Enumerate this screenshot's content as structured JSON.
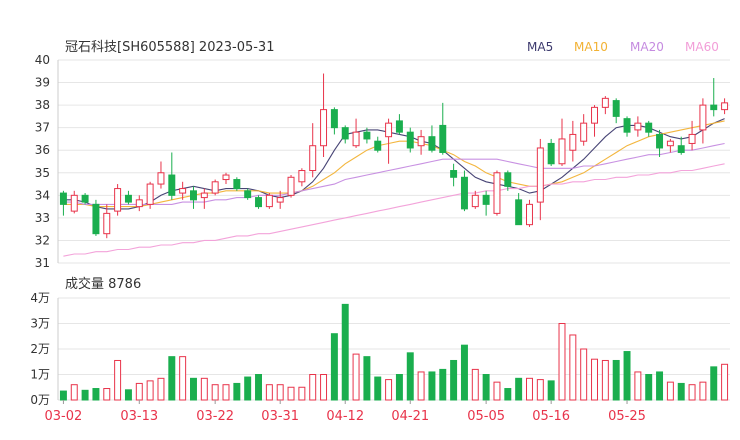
{
  "header": {
    "title": "冠石科技[SH605588] 2023-05-31"
  },
  "legend": [
    {
      "label": "MA5",
      "color": "#3d3a6e"
    },
    {
      "label": "MA10",
      "color": "#f2b234"
    },
    {
      "label": "MA20",
      "color": "#c58be0"
    },
    {
      "label": "MA60",
      "color": "#f29ed8"
    }
  ],
  "volume_panel": {
    "label": "成交量 8786"
  },
  "colors": {
    "up": "#e8334a",
    "down": "#1aae4e",
    "grid": "#e6e6e6",
    "axis_text": "#333333",
    "date_text": "#e8334a"
  },
  "chart_data": [
    {
      "type": "candlestick",
      "title": "冠石科技[SH605588] 2023-05-31",
      "ylim": [
        31,
        40
      ],
      "yticks": [
        31,
        32,
        33,
        34,
        35,
        36,
        37,
        38,
        39,
        40
      ],
      "x_tick_labels": [
        "03-02",
        "03-13",
        "03-22",
        "03-31",
        "04-12",
        "04-21",
        "05-05",
        "05-16",
        "05-25"
      ],
      "candles": [
        {
          "date": "03-02",
          "o": 34.1,
          "h": 34.2,
          "l": 33.1,
          "c": 33.6
        },
        {
          "o": 33.3,
          "h": 34.2,
          "l": 33.2,
          "c": 34.0
        },
        {
          "o": 34.0,
          "h": 34.1,
          "l": 33.6,
          "c": 33.7
        },
        {
          "o": 33.6,
          "h": 33.8,
          "l": 32.2,
          "c": 32.3
        },
        {
          "o": 32.3,
          "h": 33.6,
          "l": 32.1,
          "c": 33.2
        },
        {
          "o": 33.3,
          "h": 34.5,
          "l": 33.1,
          "c": 34.3
        },
        {
          "o": 34.0,
          "h": 34.2,
          "l": 33.6,
          "c": 33.7
        },
        {
          "date": "03-13",
          "o": 33.5,
          "h": 34.0,
          "l": 33.3,
          "c": 33.8
        },
        {
          "o": 33.6,
          "h": 34.6,
          "l": 33.4,
          "c": 34.5
        },
        {
          "o": 34.5,
          "h": 35.5,
          "l": 34.3,
          "c": 35.0
        },
        {
          "o": 34.9,
          "h": 35.9,
          "l": 33.8,
          "c": 34.0
        },
        {
          "o": 34.1,
          "h": 34.6,
          "l": 33.8,
          "c": 34.3
        },
        {
          "o": 34.2,
          "h": 34.4,
          "l": 33.4,
          "c": 33.8
        },
        {
          "o": 33.9,
          "h": 34.3,
          "l": 33.4,
          "c": 34.1
        },
        {
          "date": "03-22",
          "o": 34.1,
          "h": 34.7,
          "l": 34.0,
          "c": 34.6
        },
        {
          "o": 34.7,
          "h": 35.0,
          "l": 34.5,
          "c": 34.9
        },
        {
          "o": 34.7,
          "h": 34.8,
          "l": 34.2,
          "c": 34.3
        },
        {
          "o": 34.2,
          "h": 34.3,
          "l": 33.8,
          "c": 33.9
        },
        {
          "o": 33.9,
          "h": 34.0,
          "l": 33.4,
          "c": 33.5
        },
        {
          "o": 33.5,
          "h": 34.1,
          "l": 33.4,
          "c": 34.0
        },
        {
          "date": "03-31",
          "o": 33.7,
          "h": 34.2,
          "l": 33.4,
          "c": 33.9
        },
        {
          "o": 34.0,
          "h": 34.9,
          "l": 33.9,
          "c": 34.8
        },
        {
          "o": 34.6,
          "h": 35.2,
          "l": 34.4,
          "c": 35.1
        },
        {
          "o": 35.1,
          "h": 37.2,
          "l": 34.8,
          "c": 36.2
        },
        {
          "o": 36.2,
          "h": 39.4,
          "l": 35.7,
          "c": 37.8
        },
        {
          "o": 37.8,
          "h": 37.9,
          "l": 36.7,
          "c": 37.0
        },
        {
          "date": "04-12",
          "o": 37.0,
          "h": 37.1,
          "l": 36.3,
          "c": 36.5
        },
        {
          "o": 36.2,
          "h": 37.4,
          "l": 36.1,
          "c": 36.8
        },
        {
          "o": 36.8,
          "h": 37.0,
          "l": 36.3,
          "c": 36.5
        },
        {
          "o": 36.4,
          "h": 36.6,
          "l": 35.9,
          "c": 36.0
        },
        {
          "o": 36.6,
          "h": 37.4,
          "l": 35.4,
          "c": 37.2
        },
        {
          "o": 37.3,
          "h": 37.6,
          "l": 36.7,
          "c": 36.8
        },
        {
          "date": "04-21",
          "o": 36.8,
          "h": 37.0,
          "l": 35.9,
          "c": 36.1
        },
        {
          "o": 36.2,
          "h": 36.9,
          "l": 35.8,
          "c": 36.6
        },
        {
          "o": 36.6,
          "h": 37.1,
          "l": 35.9,
          "c": 36.0
        },
        {
          "o": 37.1,
          "h": 38.1,
          "l": 35.8,
          "c": 35.9
        },
        {
          "o": 35.1,
          "h": 35.4,
          "l": 34.4,
          "c": 34.8
        },
        {
          "o": 34.8,
          "h": 35.1,
          "l": 33.3,
          "c": 33.4
        },
        {
          "o": 33.5,
          "h": 34.2,
          "l": 33.4,
          "c": 34.0
        },
        {
          "date": "05-05",
          "o": 34.0,
          "h": 34.2,
          "l": 33.1,
          "c": 33.6
        },
        {
          "o": 33.2,
          "h": 35.1,
          "l": 33.1,
          "c": 35.0
        },
        {
          "o": 35.0,
          "h": 35.1,
          "l": 34.2,
          "c": 34.4
        },
        {
          "o": 33.8,
          "h": 34.1,
          "l": 32.7,
          "c": 32.7
        },
        {
          "o": 32.7,
          "h": 33.8,
          "l": 32.6,
          "c": 33.6
        },
        {
          "o": 33.7,
          "h": 36.5,
          "l": 32.9,
          "c": 36.1
        },
        {
          "date": "05-16",
          "o": 36.3,
          "h": 36.5,
          "l": 35.3,
          "c": 35.4
        },
        {
          "o": 35.4,
          "h": 37.4,
          "l": 35.3,
          "c": 36.5
        },
        {
          "o": 36.0,
          "h": 37.3,
          "l": 35.5,
          "c": 36.7
        },
        {
          "o": 36.4,
          "h": 37.6,
          "l": 36.2,
          "c": 37.2
        },
        {
          "o": 37.2,
          "h": 38.0,
          "l": 36.6,
          "c": 37.9
        },
        {
          "o": 37.9,
          "h": 38.4,
          "l": 37.6,
          "c": 38.3
        },
        {
          "o": 38.2,
          "h": 38.3,
          "l": 37.2,
          "c": 37.5
        },
        {
          "date": "05-25",
          "o": 37.4,
          "h": 37.5,
          "l": 36.6,
          "c": 36.8
        },
        {
          "o": 36.9,
          "h": 37.5,
          "l": 36.6,
          "c": 37.2
        },
        {
          "o": 37.2,
          "h": 37.3,
          "l": 36.6,
          "c": 36.8
        },
        {
          "o": 36.7,
          "h": 36.9,
          "l": 35.7,
          "c": 36.1
        },
        {
          "o": 36.2,
          "h": 36.5,
          "l": 35.9,
          "c": 36.4
        },
        {
          "o": 36.2,
          "h": 36.6,
          "l": 35.8,
          "c": 35.9
        },
        {
          "o": 36.3,
          "h": 37.3,
          "l": 36.0,
          "c": 36.7
        },
        {
          "o": 36.9,
          "h": 38.3,
          "l": 36.3,
          "c": 38.0
        },
        {
          "o": 38.0,
          "h": 39.2,
          "l": 37.5,
          "c": 37.8
        },
        {
          "date": "05-31",
          "o": 37.8,
          "h": 38.3,
          "l": 37.6,
          "c": 38.1
        }
      ],
      "ma": {
        "MA5": [
          33.8,
          33.8,
          33.7,
          33.5,
          33.4,
          33.4,
          33.4,
          33.5,
          33.7,
          34.0,
          34.2,
          34.3,
          34.4,
          34.3,
          34.2,
          34.3,
          34.3,
          34.3,
          34.2,
          34.0,
          33.9,
          34.0,
          34.2,
          34.6,
          35.2,
          36.0,
          36.7,
          36.8,
          36.9,
          36.9,
          36.8,
          36.7,
          36.6,
          36.4,
          36.3,
          36.0,
          35.6,
          35.2,
          34.8,
          34.6,
          34.5,
          34.4,
          34.3,
          34.1,
          34.2,
          34.5,
          34.8,
          35.2,
          35.6,
          36.1,
          36.6,
          37.0,
          37.1,
          37.1,
          37.0,
          36.8,
          36.6,
          36.5,
          36.6,
          36.9,
          37.2,
          37.4
        ],
        "MA10": [
          33.6,
          33.6,
          33.6,
          33.5,
          33.5,
          33.5,
          33.5,
          33.5,
          33.6,
          33.7,
          33.8,
          33.9,
          34.0,
          34.1,
          34.1,
          34.2,
          34.2,
          34.2,
          34.2,
          34.1,
          34.1,
          34.1,
          34.2,
          34.4,
          34.7,
          35.0,
          35.4,
          35.7,
          36.0,
          36.2,
          36.3,
          36.4,
          36.4,
          36.3,
          36.2,
          36.0,
          35.8,
          35.5,
          35.3,
          35.0,
          34.8,
          34.6,
          34.5,
          34.4,
          34.4,
          34.5,
          34.6,
          34.8,
          35.0,
          35.3,
          35.6,
          35.9,
          36.2,
          36.4,
          36.6,
          36.7,
          36.8,
          36.9,
          37.0,
          37.1,
          37.2,
          37.3
        ],
        "MA20": [
          33.7,
          33.7,
          33.6,
          33.6,
          33.6,
          33.6,
          33.6,
          33.6,
          33.6,
          33.6,
          33.6,
          33.7,
          33.7,
          33.7,
          33.8,
          33.8,
          33.9,
          33.9,
          34.0,
          34.0,
          34.0,
          34.1,
          34.2,
          34.3,
          34.4,
          34.5,
          34.7,
          34.8,
          34.9,
          35.0,
          35.1,
          35.2,
          35.3,
          35.4,
          35.5,
          35.6,
          35.6,
          35.6,
          35.6,
          35.6,
          35.6,
          35.5,
          35.4,
          35.3,
          35.2,
          35.2,
          35.2,
          35.2,
          35.3,
          35.3,
          35.4,
          35.5,
          35.6,
          35.7,
          35.8,
          35.8,
          35.9,
          36.0,
          36.0,
          36.1,
          36.2,
          36.3
        ],
        "MA60": [
          31.3,
          31.4,
          31.4,
          31.5,
          31.5,
          31.6,
          31.6,
          31.7,
          31.7,
          31.8,
          31.8,
          31.9,
          31.9,
          32.0,
          32.0,
          32.1,
          32.2,
          32.2,
          32.3,
          32.3,
          32.4,
          32.5,
          32.6,
          32.7,
          32.8,
          32.9,
          33.0,
          33.1,
          33.2,
          33.3,
          33.4,
          33.5,
          33.6,
          33.7,
          33.8,
          33.9,
          34.0,
          34.1,
          34.1,
          34.2,
          34.2,
          34.3,
          34.3,
          34.4,
          34.4,
          34.5,
          34.5,
          34.6,
          34.6,
          34.7,
          34.7,
          34.8,
          34.8,
          34.9,
          34.9,
          35.0,
          35.0,
          35.1,
          35.1,
          35.2,
          35.3,
          35.4
        ]
      }
    },
    {
      "type": "bar",
      "title": "成交量 8786",
      "ylim": [
        0,
        4
      ],
      "ytick_labels": [
        "0万",
        "1万",
        "2万",
        "3万",
        "4万"
      ],
      "volumes_wan": [
        0.35,
        0.6,
        0.38,
        0.45,
        0.45,
        1.55,
        0.4,
        0.65,
        0.75,
        0.85,
        1.7,
        1.7,
        0.85,
        0.85,
        0.6,
        0.6,
        0.65,
        0.9,
        1.0,
        0.6,
        0.6,
        0.5,
        0.5,
        1.0,
        1.0,
        2.6,
        3.75,
        1.8,
        1.7,
        0.9,
        0.8,
        1.0,
        1.85,
        1.1,
        1.1,
        1.2,
        1.55,
        2.15,
        1.2,
        1.0,
        0.7,
        0.45,
        0.85,
        0.85,
        0.8,
        0.75,
        3.0,
        2.55,
        2.0,
        1.6,
        1.55,
        1.55,
        1.9,
        1.1,
        1.0,
        1.1,
        0.7,
        0.65,
        0.6,
        0.7,
        1.3,
        1.4
      ]
    }
  ]
}
